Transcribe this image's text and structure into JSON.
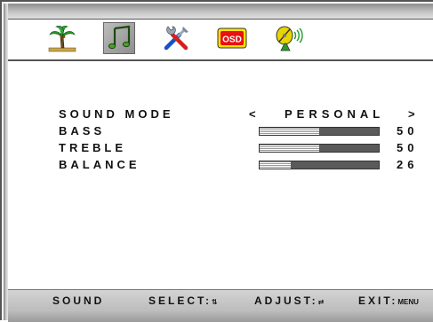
{
  "tabs": [
    {
      "icon": "palm-tree-icon",
      "selected": false
    },
    {
      "icon": "music-note-icon",
      "selected": true
    },
    {
      "icon": "tools-icon",
      "selected": false
    },
    {
      "icon": "osd-icon",
      "label": "OSD",
      "selected": false
    },
    {
      "icon": "satellite-dish-icon",
      "selected": false
    }
  ],
  "menu": {
    "sound_mode": {
      "label": "SOUND MODE",
      "arrow_left": "<",
      "value": "PERSONAL",
      "arrow_right": ">"
    },
    "bass": {
      "label": "BASS",
      "value": "50",
      "level": 0.5
    },
    "treble": {
      "label": "TREBLE",
      "value": "50",
      "level": 0.5
    },
    "balance": {
      "label": "BALANCE",
      "value": "26",
      "level": 0.26
    }
  },
  "footer": {
    "section": "SOUND",
    "select": "SELECT:",
    "select_glyph": "⇅",
    "adjust": "ADJUST:",
    "adjust_glyph": "⇄",
    "exit": "EXIT:",
    "exit_key": "MENU"
  },
  "colors": {
    "bar_fill": "#5a5a5a",
    "selected_tab": "#9a9a9a",
    "osd_red": "#e81010",
    "osd_yellow": "#ffe200"
  }
}
